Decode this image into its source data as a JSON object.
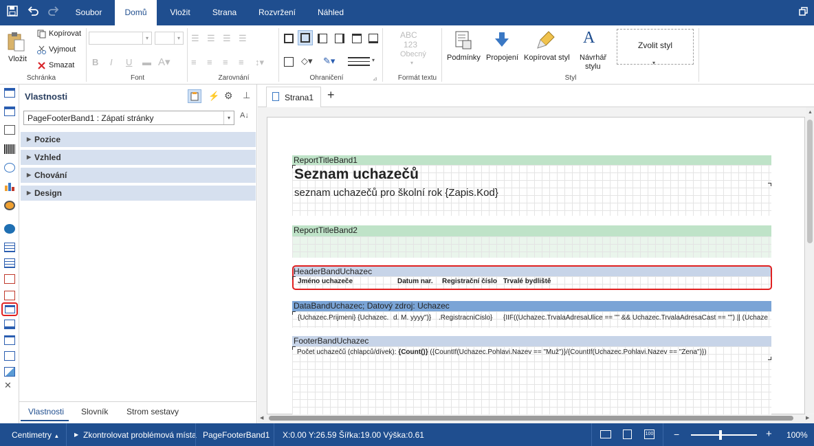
{
  "menu": {
    "tabs": [
      "Soubor",
      "Domů",
      "Vložit",
      "Strana",
      "Rozvržení",
      "Náhled"
    ]
  },
  "ribbon": {
    "clipboard": {
      "paste": "Vložit",
      "copy": "Kopírovat",
      "cut": "Vyjmout",
      "delete": "Smazat",
      "group": "Schránka"
    },
    "font_group": "Font",
    "align_group": "Zarovnání",
    "borders_group": "Ohraničení",
    "textformat": {
      "sample1": "ABC",
      "sample2": "123",
      "type": "Obecný",
      "group": "Formát textu"
    },
    "style": {
      "conditions": "Podmínky",
      "joins": "Propojení",
      "copy_style": "Kopírovat styl",
      "designer_1": "Návrhář",
      "designer_2": "stylu",
      "choose": "Zvolit styl",
      "group": "Styl"
    }
  },
  "properties": {
    "title": "Vlastnosti",
    "selected": "PageFooterBand1 : Zápatí stránky",
    "categories": [
      "Pozice",
      "Vzhled",
      "Chování",
      "Design"
    ],
    "bottom_tabs": [
      "Vlastnosti",
      "Slovník",
      "Strom sestavy"
    ]
  },
  "designer": {
    "page_tab": "Strana1",
    "bands": {
      "title1": {
        "name": "ReportTitleBand1",
        "heading": "Seznam uchazečů",
        "subtitle": "seznam uchazečů pro školní rok {Zapis.Kod}"
      },
      "title2": {
        "name": "ReportTitleBand2"
      },
      "header": {
        "name": "HeaderBandUchazec",
        "cols": [
          "Jméno uchazeče",
          "Datum nar.",
          "Registrační číslo",
          "Trvalé bydliště"
        ]
      },
      "data": {
        "name": "DataBandUchazec; Datový zdroj: Uchazec",
        "cells": [
          "{Uchazec.Prijmeni} {Uchazec.",
          "d. M. yyyy\")}",
          ".RegistracniCislo}",
          "{IIF((Uchazec.TrvalaAdresaUlice == \"\" && Uchazec.TrvalaAdresaCast == \"\") || (Uchaze"
        ]
      },
      "footer": {
        "name": "FooterBandUchazec",
        "text_plain": "Počet uchazečů (chlapců/dívek): ",
        "text_bold": "{Count()}",
        "text_rest": " ({CountIf(Uchazec.Pohlavi.Nazev == \"Muž\")}/{CountIf(Uchazec.Pohlavi.Nazev == \"Žena\")})"
      }
    }
  },
  "status": {
    "units": "Centimetry",
    "check": "Zkontrolovat problémová místa",
    "component": "PageFooterBand1",
    "coords": "X:0.00 Y:26.59 Šířka:19.00 Výška:0.61",
    "zoom": "100%"
  },
  "colors": {
    "brand": "#1f4e8f",
    "band_title": "#bfe3c8",
    "band_header": "#c7d4e8",
    "band_data": "#7aa4d6",
    "highlight": "#e02020"
  }
}
